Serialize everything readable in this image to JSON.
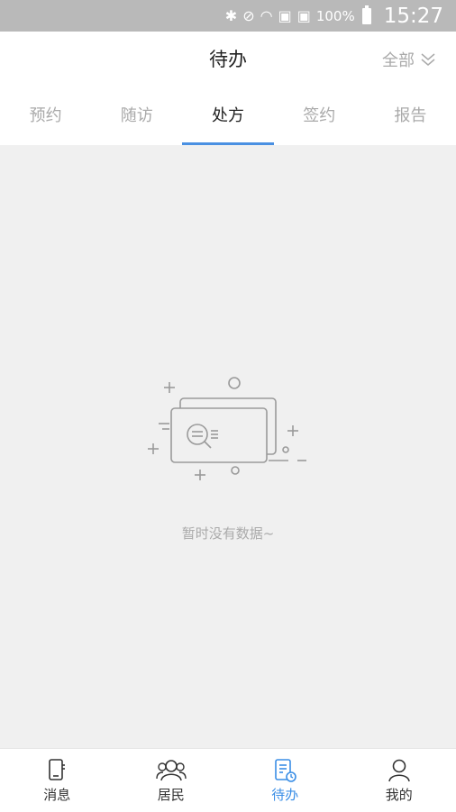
{
  "status_bar": {
    "icons": [
      "bluetooth-icon",
      "mute-icon",
      "wifi-icon",
      "sim1-icon",
      "sim2-icon",
      "battery-icon"
    ],
    "battery": "100%",
    "time": "15:27"
  },
  "header": {
    "title": "待办",
    "filter_label": "全部"
  },
  "tabs": [
    {
      "label": "预约",
      "active": false
    },
    {
      "label": "随访",
      "active": false
    },
    {
      "label": "处方",
      "active": true
    },
    {
      "label": "签约",
      "active": false
    },
    {
      "label": "报告",
      "active": false
    }
  ],
  "empty_state": {
    "message": "暂时没有数据~",
    "icon": "empty-search-card-icon"
  },
  "bottom_nav": [
    {
      "label": "消息",
      "icon": "message-icon",
      "active": false
    },
    {
      "label": "居民",
      "icon": "residents-icon",
      "active": false
    },
    {
      "label": "待办",
      "icon": "todo-icon",
      "active": true
    },
    {
      "label": "我的",
      "icon": "profile-icon",
      "active": false
    }
  ],
  "colors": {
    "accent": "#3a8ee6",
    "tab_indicator": "#4a90e2",
    "status_bar": "#b9b9b9",
    "background": "#f0f0f0"
  }
}
